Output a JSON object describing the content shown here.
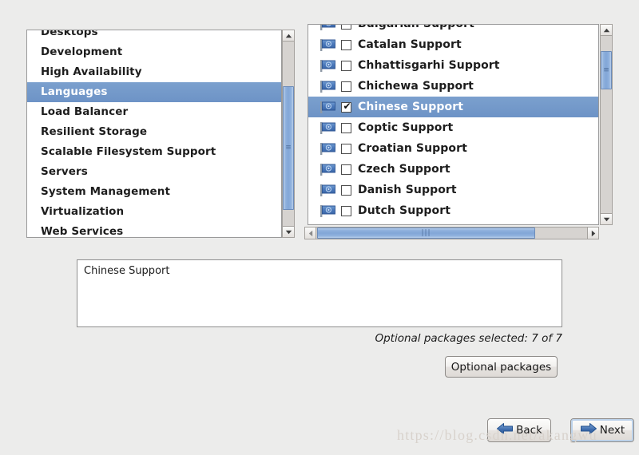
{
  "window": {
    "background_color": "#ececeb",
    "accent_color": "#6d93c6",
    "selection_text_color": "#ffffff"
  },
  "group_list": {
    "name": "package-group-list",
    "scroll_position": "middle",
    "items": [
      {
        "label": "Desktops",
        "selected": false,
        "clipped": true
      },
      {
        "label": "Development",
        "selected": false
      },
      {
        "label": "High Availability",
        "selected": false
      },
      {
        "label": "Languages",
        "selected": true
      },
      {
        "label": "Load Balancer",
        "selected": false
      },
      {
        "label": "Resilient Storage",
        "selected": false
      },
      {
        "label": "Scalable Filesystem Support",
        "selected": false
      },
      {
        "label": "Servers",
        "selected": false
      },
      {
        "label": "System Management",
        "selected": false
      },
      {
        "label": "Virtualization",
        "selected": false
      },
      {
        "label": "Web Services",
        "selected": false
      }
    ]
  },
  "package_list": {
    "name": "language-package-list",
    "icon": "flag-icon",
    "items": [
      {
        "label": "Bulgarian Support",
        "checked": false,
        "selected": false,
        "clipped": true
      },
      {
        "label": "Catalan Support",
        "checked": false,
        "selected": false
      },
      {
        "label": "Chhattisgarhi Support",
        "checked": false,
        "selected": false
      },
      {
        "label": "Chichewa Support",
        "checked": false,
        "selected": false
      },
      {
        "label": "Chinese Support",
        "checked": true,
        "selected": true
      },
      {
        "label": "Coptic Support",
        "checked": false,
        "selected": false
      },
      {
        "label": "Croatian Support",
        "checked": false,
        "selected": false
      },
      {
        "label": "Czech Support",
        "checked": false,
        "selected": false
      },
      {
        "label": "Danish Support",
        "checked": false,
        "selected": false
      },
      {
        "label": "Dutch Support",
        "checked": false,
        "selected": false,
        "clipped": true
      }
    ]
  },
  "scrollbars": {
    "group_vertical": {
      "up_icon": "chevron-up-icon",
      "down_icon": "chevron-down-icon",
      "grip": "≡"
    },
    "package_vertical": {
      "up_icon": "chevron-up-icon",
      "down_icon": "chevron-down-icon",
      "grip": "≡"
    },
    "package_horizontal": {
      "left_icon": "chevron-left-icon",
      "right_icon": "chevron-right-icon",
      "grip": "|||"
    }
  },
  "description": {
    "text": "Chinese Support"
  },
  "status": {
    "text": "Optional packages selected: 7 of 7",
    "selected_count": 7,
    "total_count": 7
  },
  "buttons": {
    "optional_packages": "Optional packages",
    "back": "Back",
    "next": "Next"
  },
  "watermark": {
    "text": "https://blog.csdn.net/akangwu"
  }
}
